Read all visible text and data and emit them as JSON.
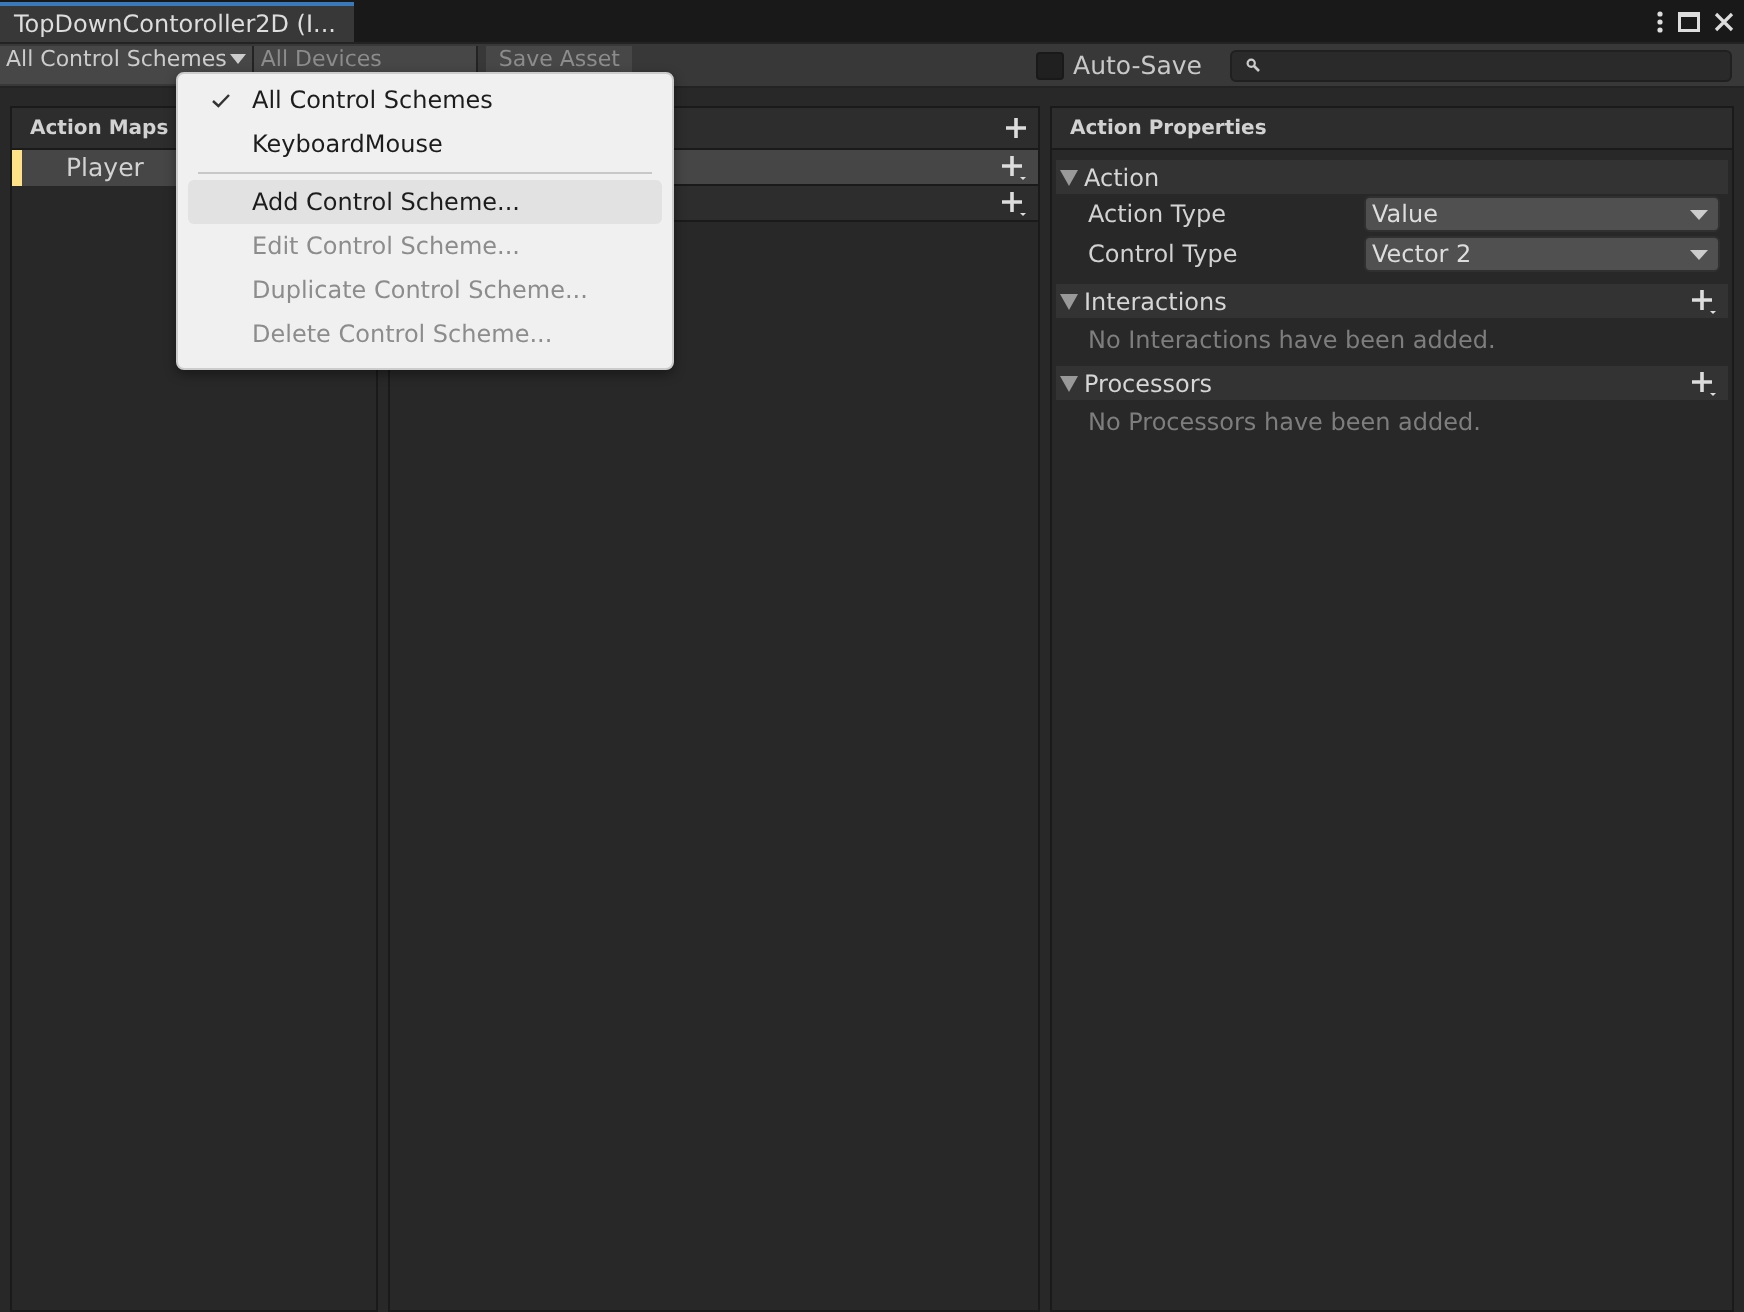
{
  "window": {
    "tab_title": "TopDownContoroller2D (I..."
  },
  "toolbar": {
    "scheme_dropdown": "All Control Schemes",
    "devices_dropdown": {
      "label": "All Devices",
      "disabled": true
    },
    "save_button": {
      "label": "Save Asset",
      "disabled": true
    },
    "auto_save": {
      "label": "Auto-Save",
      "checked": false
    }
  },
  "action_maps": {
    "title": "Action Maps",
    "items": [
      {
        "name": "Player",
        "selected": true
      }
    ]
  },
  "properties": {
    "title": "Action Properties",
    "sections": [
      {
        "title": "Action",
        "expanded": true,
        "fields": [
          {
            "label": "Action Type",
            "value": "Value"
          },
          {
            "label": "Control Type",
            "value": "Vector 2"
          }
        ]
      },
      {
        "title": "Interactions",
        "expanded": true,
        "empty_text": "No Interactions have been added."
      },
      {
        "title": "Processors",
        "expanded": true,
        "empty_text": "No Processors have been added."
      }
    ]
  },
  "menu": [
    {
      "kind": "item",
      "label": "All Control Schemes",
      "checked": true,
      "disabled": false,
      "selected": false
    },
    {
      "kind": "item",
      "label": "KeyboardMouse",
      "checked": false,
      "disabled": false,
      "selected": false
    },
    {
      "kind": "separator"
    },
    {
      "kind": "item",
      "label": "Add Control Scheme...",
      "checked": false,
      "disabled": false,
      "selected": true
    },
    {
      "kind": "item",
      "label": "Edit Control Scheme...",
      "checked": false,
      "disabled": true,
      "selected": false
    },
    {
      "kind": "item",
      "label": "Duplicate Control Scheme...",
      "checked": false,
      "disabled": true,
      "selected": false
    },
    {
      "kind": "item",
      "label": "Delete Control Scheme...",
      "checked": false,
      "disabled": true,
      "selected": false
    }
  ]
}
